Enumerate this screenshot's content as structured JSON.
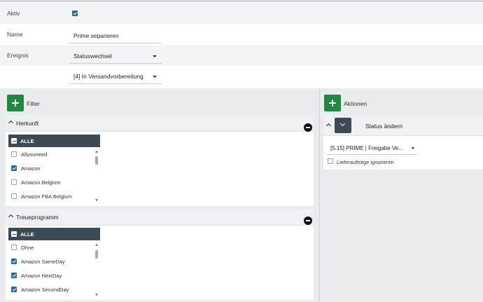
{
  "form": {
    "active_label": "Aktiv",
    "active_checked": true,
    "name_label": "Name",
    "name_value": "Prime separieren",
    "event_label": "Ereignis",
    "event_value": "Statuswechsel",
    "status_value": "[4] In Versandvorbereitung"
  },
  "filter": {
    "add_icon": "plus-icon",
    "title": "Filter",
    "herkunft": {
      "title": "Herkunft",
      "all_label": "ALLE",
      "items": [
        {
          "label": "Allyouneed",
          "checked": false
        },
        {
          "label": "Amazon",
          "checked": true
        },
        {
          "label": "Amazon Belgium",
          "checked": false
        },
        {
          "label": "Amazon FBA Belgium",
          "checked": false
        }
      ]
    },
    "treueprogramm": {
      "title": "Treueprogramm",
      "all_label": "ALLE",
      "items": [
        {
          "label": "Ohne",
          "checked": false
        },
        {
          "label": "Amazon SameDay",
          "checked": true
        },
        {
          "label": "Amazon NextDay",
          "checked": true
        },
        {
          "label": "Amazon SecondDay",
          "checked": true
        }
      ]
    }
  },
  "actions": {
    "add_icon": "plus-icon",
    "title": "Aktionen",
    "status_card": {
      "title": "Status ändern",
      "select_value": "[5.15] PRIME | Freigabe Ve...",
      "ignore_label": "Lieferaufträge ignorieren",
      "ignore_checked": false
    }
  },
  "colors": {
    "accent_green": "#1e8a3e",
    "list_header": "#3c4a55",
    "check_blue": "#1f6fa3"
  }
}
